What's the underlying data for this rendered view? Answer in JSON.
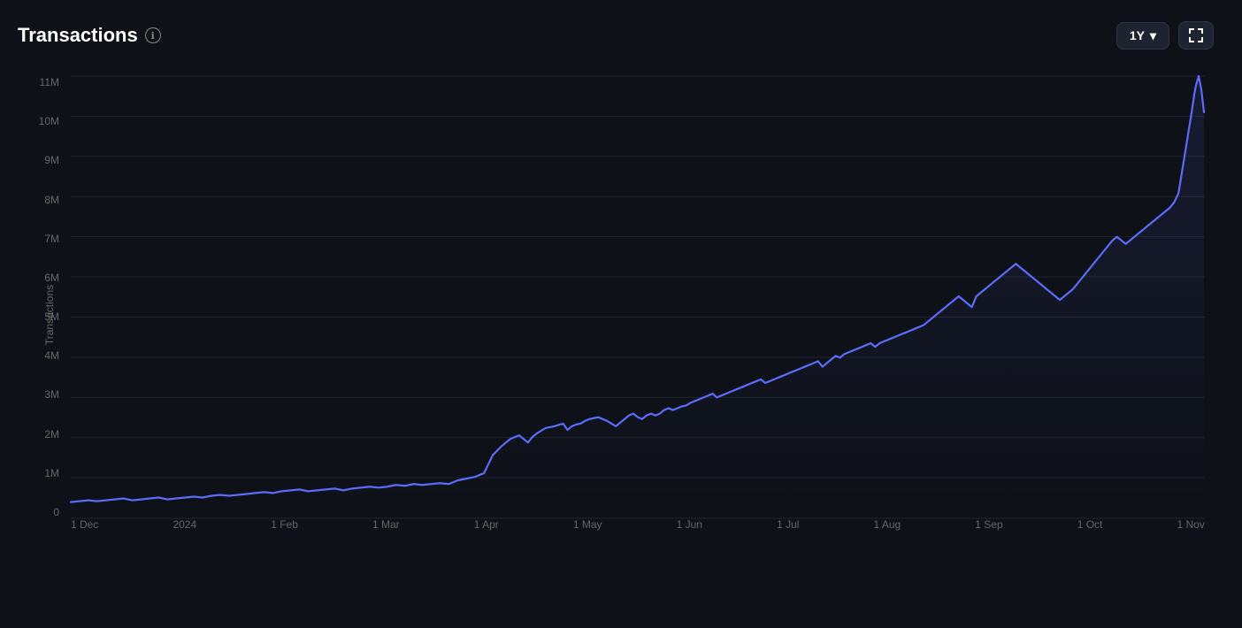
{
  "header": {
    "title": "Transactions",
    "info_icon": "ℹ",
    "period": "1Y",
    "chevron": "▾"
  },
  "y_axis": {
    "label": "Transactions",
    "ticks": [
      "11M",
      "10M",
      "9M",
      "8M",
      "7M",
      "6M",
      "5M",
      "4M",
      "3M",
      "2M",
      "1M",
      "0"
    ]
  },
  "x_axis": {
    "ticks": [
      "1 Dec",
      "2024",
      "1 Feb",
      "1 Mar",
      "1 Apr",
      "1 May",
      "1 Jun",
      "1 Jul",
      "1 Aug",
      "1 Sep",
      "1 Oct",
      "1 Nov"
    ]
  },
  "colors": {
    "background": "#0e1117",
    "line": "#5b6cf9",
    "grid": "#1e2330",
    "text": "#666666"
  }
}
